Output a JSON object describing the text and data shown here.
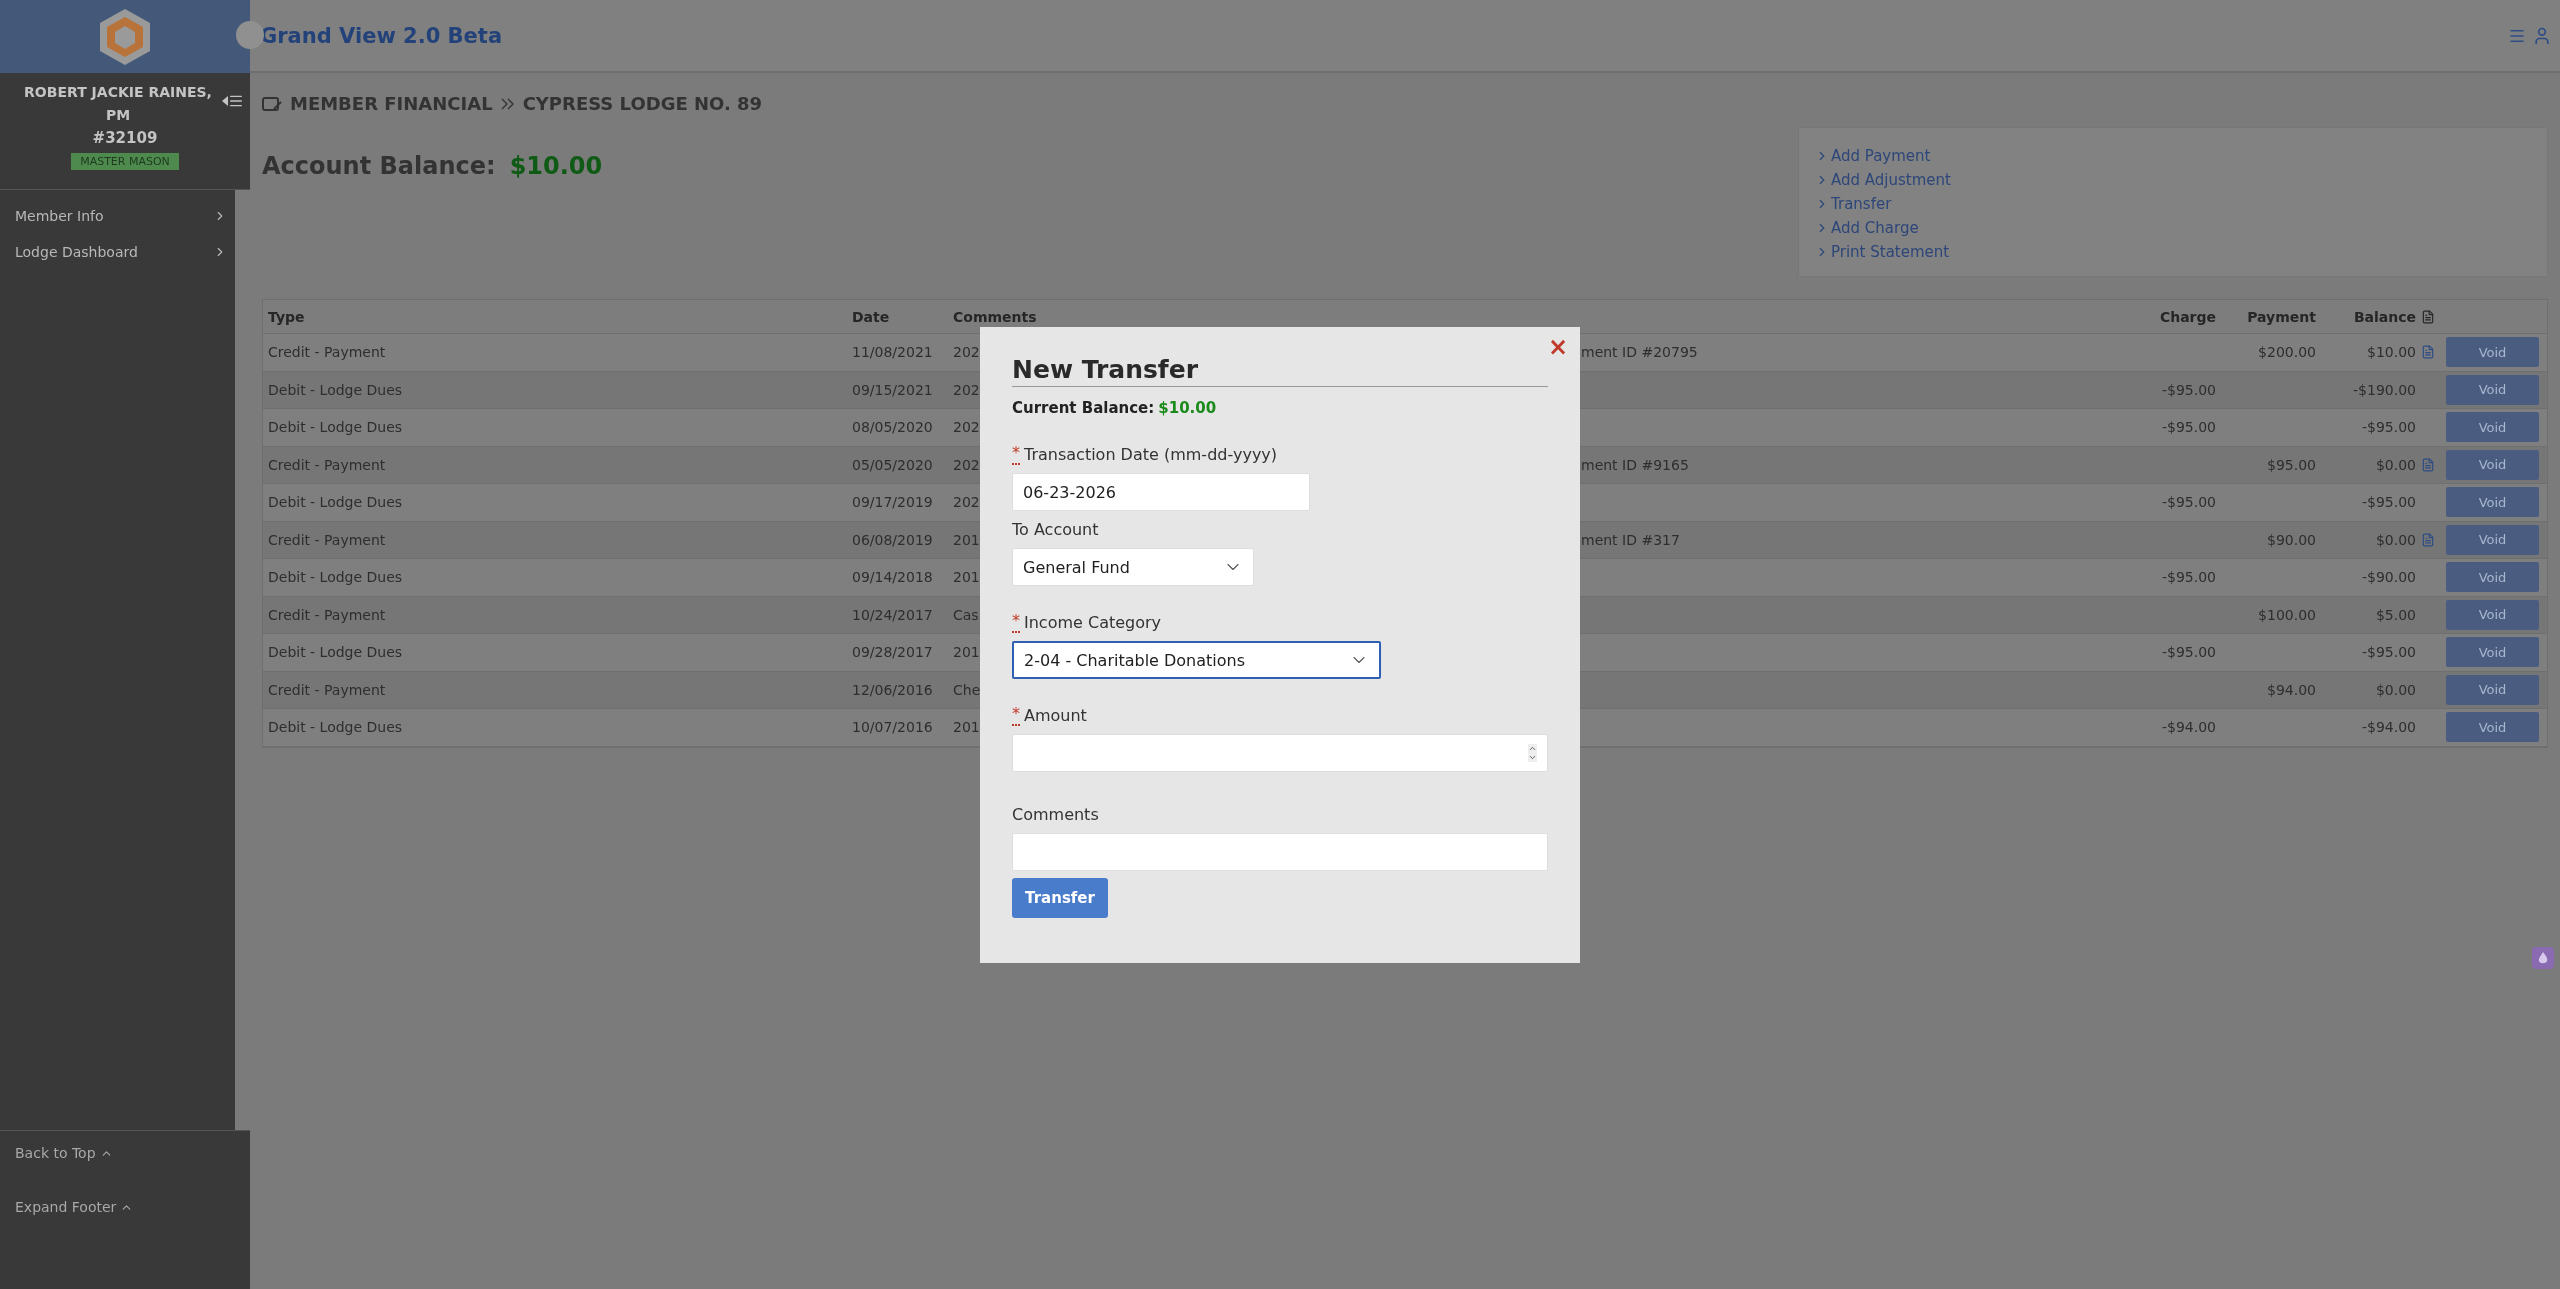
{
  "header": {
    "title": "Grand View 2.0 Beta"
  },
  "sidebar": {
    "member_name": "ROBERT JACKIE RAINES, PM",
    "member_number": "#32109",
    "badge": "MASTER MASON",
    "items": [
      {
        "label": "Member Info"
      },
      {
        "label": "Lodge Dashboard"
      }
    ],
    "footer_links": [
      {
        "label": "Back to Top"
      },
      {
        "label": "Expand Footer"
      }
    ]
  },
  "breadcrumb": [
    "MEMBER FINANCIAL",
    "CYPRESS LODGE NO. 89"
  ],
  "account_balance": {
    "label": "Account Balance:",
    "value": "$10.00"
  },
  "actions": [
    "Add Payment",
    "Add Adjustment",
    "Transfer",
    "Add Charge",
    "Print Statement"
  ],
  "table": {
    "columns": [
      "Type",
      "Date",
      "Comments",
      "Charge",
      "Payment",
      "Balance"
    ],
    "rows": [
      {
        "type": "Credit - Payment",
        "date": "11/08/2021",
        "comment": "202",
        "comment_2": "ment ID #20795",
        "charge": "",
        "payment": "$200.00",
        "balance": "$10.00",
        "receipt": true,
        "action": "Void"
      },
      {
        "type": "Debit - Lodge Dues",
        "date": "09/15/2021",
        "comment": "202",
        "comment_2": "",
        "charge": "-$95.00",
        "payment": "",
        "balance": "-$190.00",
        "receipt": false,
        "action": "Void"
      },
      {
        "type": "Debit - Lodge Dues",
        "date": "08/05/2020",
        "comment": "202",
        "comment_2": "",
        "charge": "-$95.00",
        "payment": "",
        "balance": "-$95.00",
        "receipt": false,
        "action": "Void"
      },
      {
        "type": "Credit - Payment",
        "date": "05/05/2020",
        "comment": "202",
        "comment_2": "ment ID #9165",
        "charge": "",
        "payment": "$95.00",
        "balance": "$0.00",
        "receipt": true,
        "action": "Void"
      },
      {
        "type": "Debit - Lodge Dues",
        "date": "09/17/2019",
        "comment": "202",
        "comment_2": "",
        "charge": "-$95.00",
        "payment": "",
        "balance": "-$95.00",
        "receipt": false,
        "action": "Void"
      },
      {
        "type": "Credit - Payment",
        "date": "06/08/2019",
        "comment": "201",
        "comment_2": "ment ID #317",
        "charge": "",
        "payment": "$90.00",
        "balance": "$0.00",
        "receipt": true,
        "action": "Void"
      },
      {
        "type": "Debit - Lodge Dues",
        "date": "09/14/2018",
        "comment": "201",
        "comment_2": "",
        "charge": "-$95.00",
        "payment": "",
        "balance": "-$90.00",
        "receipt": false,
        "action": "Void"
      },
      {
        "type": "Credit - Payment",
        "date": "10/24/2017",
        "comment": "Cas",
        "comment_2": "",
        "charge": "",
        "payment": "$100.00",
        "balance": "$5.00",
        "receipt": false,
        "action": "Void"
      },
      {
        "type": "Debit - Lodge Dues",
        "date": "09/28/2017",
        "comment": "201",
        "comment_2": "",
        "charge": "-$95.00",
        "payment": "",
        "balance": "-$95.00",
        "receipt": false,
        "action": "Void"
      },
      {
        "type": "Credit - Payment",
        "date": "12/06/2016",
        "comment": "Che",
        "comment_2": "",
        "charge": "",
        "payment": "$94.00",
        "balance": "$0.00",
        "receipt": false,
        "action": "Void"
      },
      {
        "type": "Debit - Lodge Dues",
        "date": "10/07/2016",
        "comment": "201",
        "comment_2": "",
        "charge": "-$94.00",
        "payment": "",
        "balance": "-$94.00",
        "receipt": false,
        "action": "Void"
      }
    ]
  },
  "modal": {
    "title": "New Transfer",
    "close": "×",
    "balance_label": "Current Balance:",
    "balance_value": "$10.00",
    "fields": [
      {
        "kind": "input",
        "label": "Transaction Date (mm-dd-yyyy)",
        "required": true,
        "value": "06-23-2026"
      },
      {
        "kind": "select",
        "label": "To Account",
        "required": false,
        "value": "General Fund",
        "focused": false
      },
      {
        "kind": "select",
        "label": "Income Category",
        "required": true,
        "value": "2-04 - Charitable Donations",
        "focused": true
      },
      {
        "kind": "number",
        "label": "Amount",
        "required": true
      },
      {
        "kind": "input",
        "label": "Comments",
        "required": false
      }
    ],
    "required_mark": "*",
    "button": "Transfer"
  }
}
